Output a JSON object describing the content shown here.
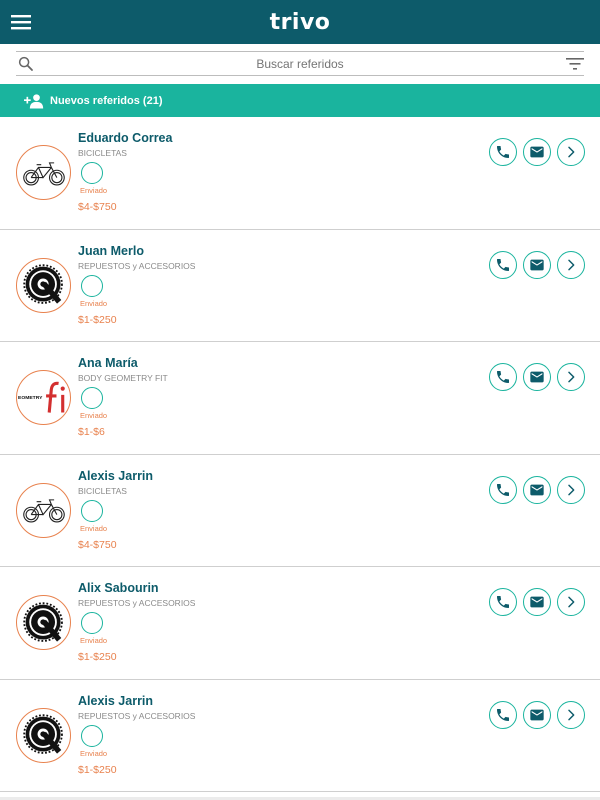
{
  "app": {
    "title": "trivo"
  },
  "search": {
    "placeholder": "Buscar referidos"
  },
  "section": {
    "title": "Nuevos referidos (21)"
  },
  "colors": {
    "header": "#0d5b6a",
    "accent": "#1ab49e",
    "orange": "#e8824e"
  },
  "icons": {
    "menu": "menu-icon",
    "search": "search-icon",
    "filter": "filter-icon",
    "add_person": "add-person-icon",
    "phone": "phone-icon",
    "mail": "mail-icon",
    "chevron": "chevron-right-icon"
  },
  "referrals": [
    {
      "name": "Eduardo Correa",
      "category": "BICICLETAS",
      "status": "Enviado",
      "price": "$4-$750",
      "avatar": "bicycle"
    },
    {
      "name": "Juan Merlo",
      "category": "REPUESTOS y ACCESORIOS",
      "status": "Enviado",
      "price": "$1-$250",
      "avatar": "crankset"
    },
    {
      "name": "Ana María",
      "category": "BODY GEOMETRY FIT",
      "status": "Enviado",
      "price": "$1-$6",
      "avatar": "geometry-fit",
      "avatar_text": "EOMETRY"
    },
    {
      "name": "Alexis Jarrin",
      "category": "BICICLETAS",
      "status": "Enviado",
      "price": "$4-$750",
      "avatar": "bicycle"
    },
    {
      "name": "Alix Sabourin",
      "category": "REPUESTOS y ACCESORIOS",
      "status": "Enviado",
      "price": "$1-$250",
      "avatar": "crankset"
    },
    {
      "name": "Alexis Jarrin",
      "category": "REPUESTOS y ACCESORIOS",
      "status": "Enviado",
      "price": "$1-$250",
      "avatar": "crankset"
    }
  ]
}
